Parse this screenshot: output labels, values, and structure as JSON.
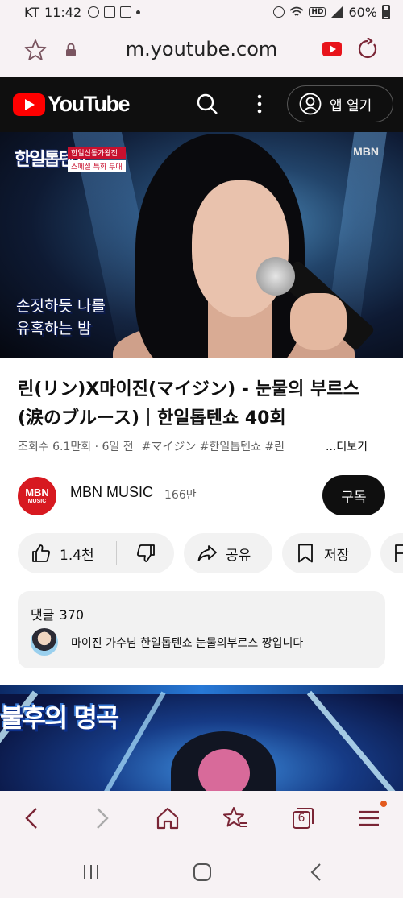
{
  "status_bar": {
    "carrier": "KT",
    "time": "11:42",
    "battery": "60%",
    "network_badge": "HD",
    "icons": [
      "sol-bank-icon",
      "gallery-icon",
      "notification-icon",
      "alarm-icon",
      "wifi-icon",
      "signal-icon",
      "battery-icon"
    ]
  },
  "browser": {
    "url": "m.youtube.com",
    "tab_count": "6"
  },
  "youtube_header": {
    "logo_text": "YouTube",
    "open_app_label": "앱 열기",
    "accent": "#ff0000"
  },
  "video": {
    "show_logo": "한일톱텐쇼",
    "tags": [
      "한일신동가왕전",
      "스페셜 특화 무대"
    ],
    "broadcaster": "MBN",
    "caption_line1": "손짓하듯 나를",
    "caption_line2": "유혹하는 밤"
  },
  "title": "린(リン)X마이진(マイジン) - 눈물의 부르스 (涙のブルース)｜한일톱텐쇼 40회",
  "meta": {
    "views": "조회수 6.1만회 · 6일 전",
    "hashtags": "#マイジン #한일톱텐쇼 #린",
    "more_label": "...더보기"
  },
  "channel": {
    "avatar_line1": "MBN",
    "avatar_line2": "MUSIC",
    "name": "MBN MUSIC",
    "subscribers": "166만",
    "subscribe_label": "구독"
  },
  "actions": {
    "likes": "1.4천",
    "share_label": "공유",
    "save_label": "저장"
  },
  "comments": {
    "label": "댓글",
    "count": "370",
    "top_comment": "마이진 가수님 한일톱텐쇼 눈물의부르스 짱입니다"
  },
  "next_video": {
    "heading": "불후의 명곡"
  }
}
